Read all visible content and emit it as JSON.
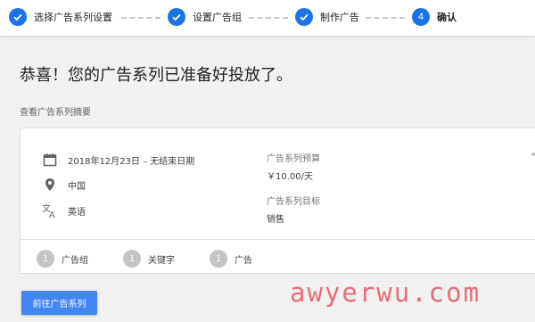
{
  "stepper": {
    "steps": [
      {
        "label": "选择广告系列设置",
        "state": "done"
      },
      {
        "label": "设置广告组",
        "state": "done"
      },
      {
        "label": "制作广告",
        "state": "done"
      },
      {
        "label": "确认",
        "state": "active",
        "number": "4"
      }
    ]
  },
  "headline": "恭喜！您的广告系列已准备好投放了。",
  "summary_link": "查看广告系列摘要",
  "card": {
    "date": "2018年12月23日 – 无结束日期",
    "location": "中国",
    "language": "英语",
    "budget_label": "广告系列预算",
    "budget_value": "￥10.00/天",
    "goal_label": "广告系列目标",
    "goal_value": "销售",
    "counters": [
      {
        "count": "1",
        "label": "广告组"
      },
      {
        "count": "1",
        "label": "关键字"
      },
      {
        "count": "1",
        "label": "广告"
      }
    ]
  },
  "go_button": "前往广告系列",
  "watermark": "awyerwu.com",
  "colors": {
    "accent": "#1a73e8",
    "button": "#4285f4",
    "badge": "#c4c4c4",
    "watermark": "#e96b78"
  },
  "icons": {
    "step_done": "check-icon",
    "date": "calendar-icon",
    "location": "location-pin-icon",
    "language": "translate-icon"
  }
}
